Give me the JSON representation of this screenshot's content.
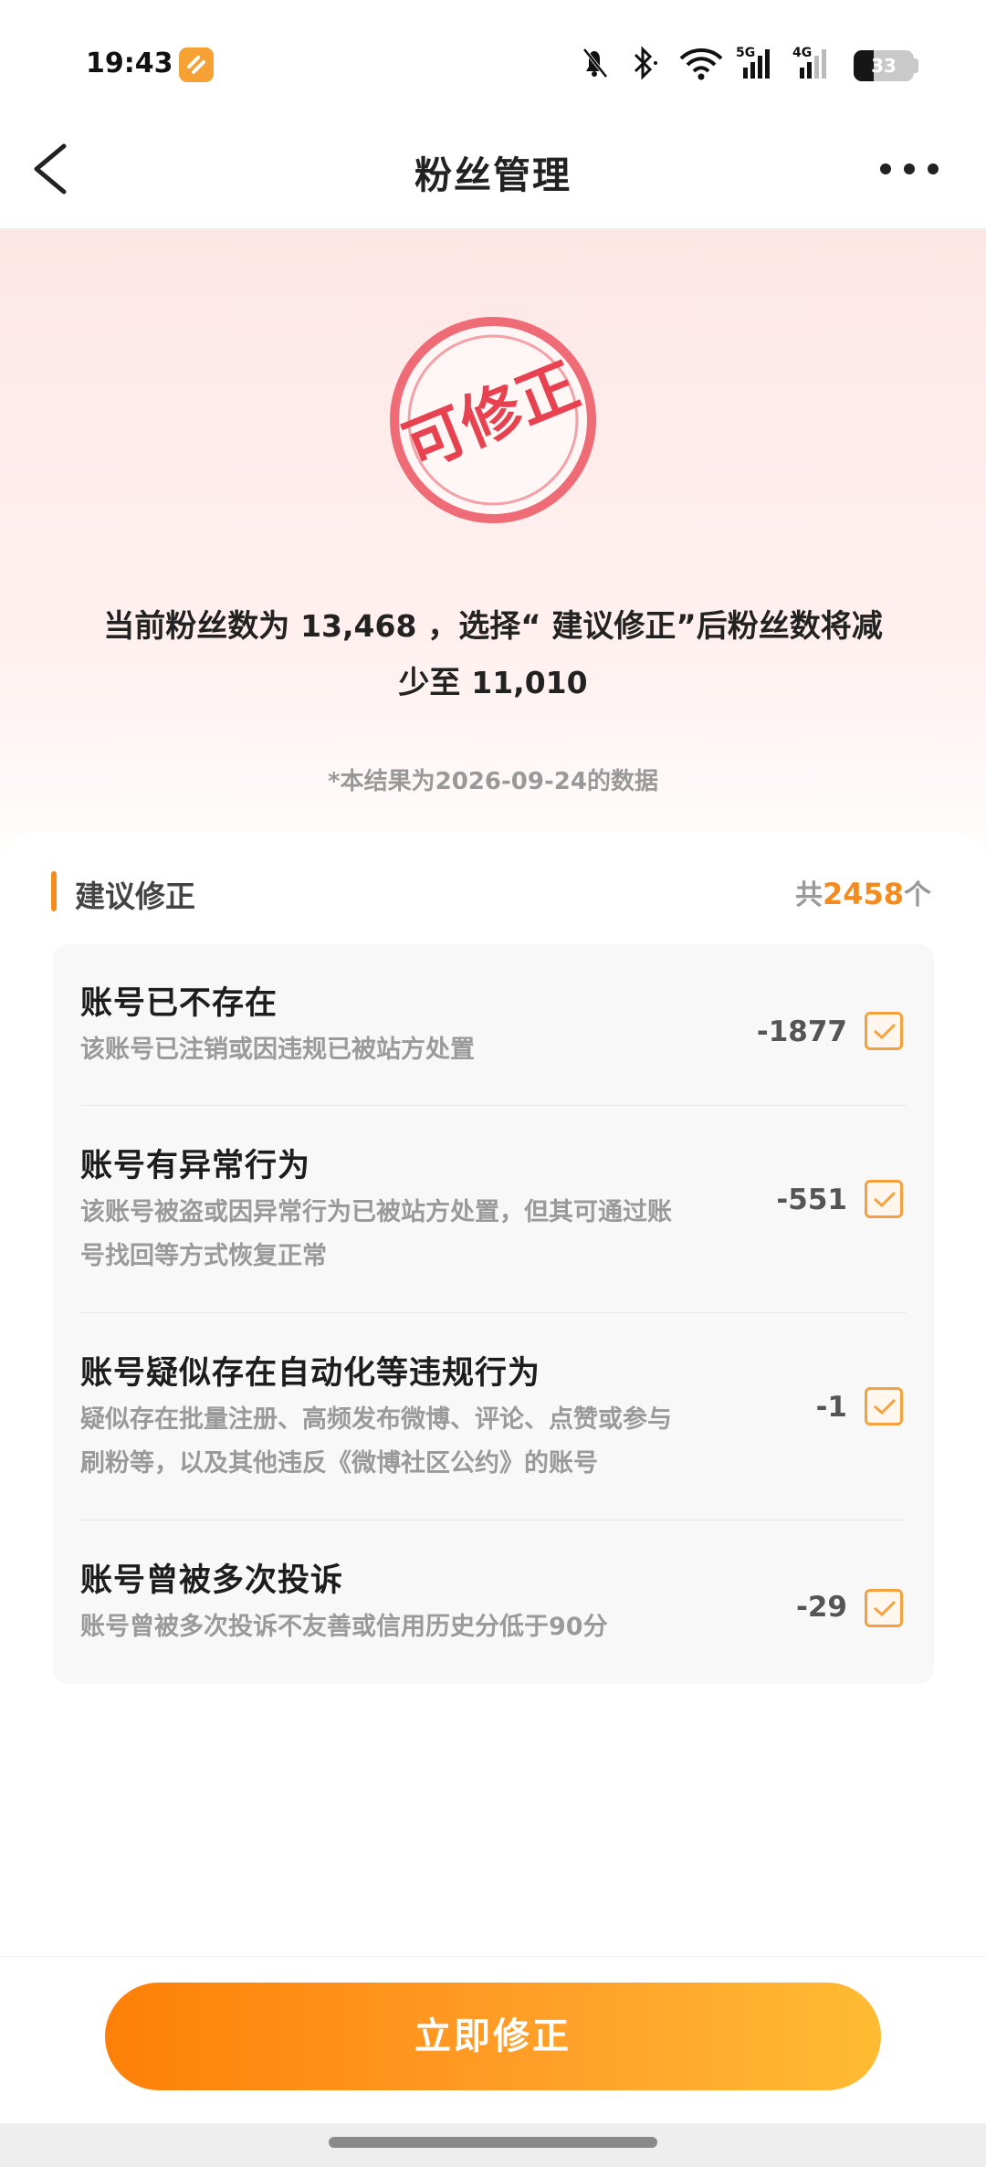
{
  "status_bar": {
    "time": "19:43",
    "battery": "33",
    "battery_level": 0.33,
    "network_5g": "5G",
    "network_4g": "4G"
  },
  "nav": {
    "title": "粉丝管理",
    "back_icon": "chevron-left-icon",
    "more_icon": "more-dots-icon"
  },
  "hero": {
    "stamp_text": "可修正",
    "summary_part1": "当前粉丝数为",
    "current_fans": "13,468",
    "summary_part2": "，选择“ 建议修正”后粉丝数将减",
    "summary_part3": "少至",
    "result_fans": "11,010",
    "data_note": "*本结果为2026-09-24的数据"
  },
  "section": {
    "title": "建议修正",
    "total_prefix": "共",
    "total_count": "2458",
    "total_suffix": "个"
  },
  "items": [
    {
      "title": "账号已不存在",
      "desc_line1": "该账号已注销或因违规已被站方处置",
      "desc_line2": "",
      "count": "-1877",
      "checked": true
    },
    {
      "title": "账号有异常行为",
      "desc_line1": "该账号被盗或因异常行为已被站方处置，但其可通过账",
      "desc_line2": "号找回等方式恢复正常",
      "count": "-551",
      "checked": true
    },
    {
      "title": "账号疑似存在自动化等违规行为",
      "desc_line1": "疑似存在批量注册、高频发布微博、评论、点赞或参与",
      "desc_line2": "刷粉等，以及其他违反《微博社区公约》的账号",
      "count": "-1",
      "checked": true
    },
    {
      "title": "账号曾被多次投诉",
      "desc_line1": "账号曾被多次投诉不友善或信用历史分低于90分",
      "desc_line2": "",
      "count": "-29",
      "checked": true
    }
  ],
  "action": {
    "label": "立即修正"
  },
  "colors": {
    "accent": "#f58b1c",
    "stamp": "#e8414f",
    "button_start": "#fe8008",
    "button_end": "#ffbb33"
  }
}
